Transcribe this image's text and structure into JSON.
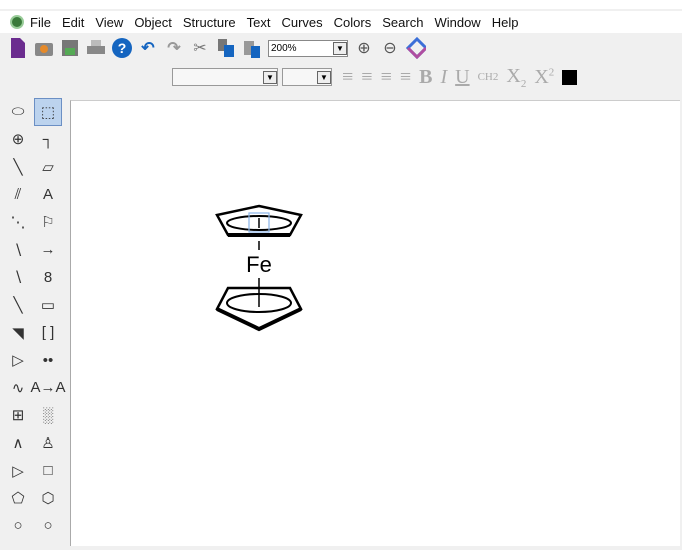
{
  "menu": [
    "File",
    "Edit",
    "View",
    "Object",
    "Structure",
    "Text",
    "Curves",
    "Colors",
    "Search",
    "Window",
    "Help"
  ],
  "toolbar": {
    "zoom_value": "200%",
    "icons": [
      "new-document",
      "open",
      "save",
      "print",
      "help",
      "undo",
      "redo",
      "cut",
      "copy",
      "paste"
    ],
    "zoom_in": "zoom-in",
    "zoom_out": "zoom-out",
    "logo": "chemdraw-logo"
  },
  "format_toolbar": {
    "font": "",
    "size": "",
    "bold": "B",
    "italic": "I",
    "underline": "U",
    "formula": "CH2",
    "subscript": "X2",
    "superscript": "X2",
    "color": "#000000"
  },
  "palette": [
    {
      "name": "lasso",
      "g": "⬭"
    },
    {
      "name": "marquee",
      "g": "⬚"
    },
    {
      "name": "rotate",
      "g": "⊕"
    },
    {
      "name": "chain",
      "g": "┐"
    },
    {
      "name": "single-bond",
      "g": "╲"
    },
    {
      "name": "eraser",
      "g": "▱"
    },
    {
      "name": "double-bond",
      "g": "⫽"
    },
    {
      "name": "text",
      "g": "A"
    },
    {
      "name": "dashed-bond",
      "g": "⋱"
    },
    {
      "name": "pen",
      "g": "⚐"
    },
    {
      "name": "hashed-bond",
      "g": "∖"
    },
    {
      "name": "arrow",
      "g": "→"
    },
    {
      "name": "hashed-wedge",
      "g": "∖"
    },
    {
      "name": "orbital",
      "g": "8"
    },
    {
      "name": "bold-bond",
      "g": "╲"
    },
    {
      "name": "drawing-elements",
      "g": "▭"
    },
    {
      "name": "wedge-bond",
      "g": "◥"
    },
    {
      "name": "brackets",
      "g": "[ ]"
    },
    {
      "name": "hollow-wedge",
      "g": "▷"
    },
    {
      "name": "chemical-symbols",
      "g": "••"
    },
    {
      "name": "wavy-bond",
      "g": "∿"
    },
    {
      "name": "acs-document",
      "g": "A→A"
    },
    {
      "name": "table",
      "g": "⊞"
    },
    {
      "name": "tlc-plate",
      "g": "░"
    },
    {
      "name": "query",
      "g": "∧"
    },
    {
      "name": "templates",
      "g": "♙"
    },
    {
      "name": "play",
      "g": "▷"
    },
    {
      "name": "cyclobutane",
      "g": "□"
    },
    {
      "name": "cyclopentane",
      "g": "⬠"
    },
    {
      "name": "cyclohexane",
      "g": "⬡"
    },
    {
      "name": "cycloheptane",
      "g": "○"
    },
    {
      "name": "cyclooctane",
      "g": "○"
    }
  ],
  "molecule": {
    "atom_label": "Fe"
  }
}
